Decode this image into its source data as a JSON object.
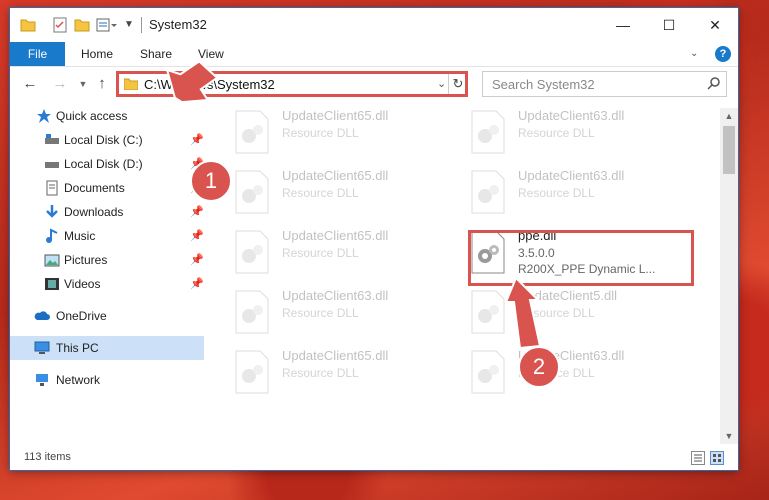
{
  "window": {
    "title": "System32",
    "controls": {
      "minimize": "—",
      "maximize": "☐",
      "close": "✕"
    }
  },
  "ribbon": {
    "tabs": {
      "file": "File",
      "home": "Home",
      "share": "Share",
      "view": "View"
    },
    "help": "?"
  },
  "address": {
    "path": "C:\\Windows\\System32",
    "search_placeholder": "Search System32"
  },
  "sidebar": {
    "items": [
      {
        "label": "Quick access",
        "icon": "star-icon"
      },
      {
        "label": "Local Disk (C:)",
        "icon": "drive-icon"
      },
      {
        "label": "Local Disk (D:)",
        "icon": "drive-icon"
      },
      {
        "label": "Documents",
        "icon": "documents-icon"
      },
      {
        "label": "Downloads",
        "icon": "download-icon"
      },
      {
        "label": "Music",
        "icon": "music-icon"
      },
      {
        "label": "Pictures",
        "icon": "pictures-icon"
      },
      {
        "label": "Videos",
        "icon": "videos-icon"
      },
      {
        "label": "OneDrive",
        "icon": "cloud-icon"
      },
      {
        "label": "This PC",
        "icon": "computer-icon"
      },
      {
        "label": "Network",
        "icon": "network-icon"
      }
    ]
  },
  "files": [
    {
      "name": "UpdateClient65.dll",
      "desc": "Resource DLL"
    },
    {
      "name": "UpdateClient63.dll",
      "desc": "Resource DLL"
    },
    {
      "name": "UpdateClient65.dll",
      "desc": "Resource DLL"
    },
    {
      "name": "UpdateClient63.dll",
      "desc": "Resource DLL"
    },
    {
      "name": "UpdateClient65.dll",
      "desc": "Resource DLL"
    },
    {
      "name": "ppe.dll",
      "desc": "3.5.0.0",
      "desc2": "R200X_PPE Dynamic L..."
    },
    {
      "name": "UpdateClient63.dll",
      "desc": "Resource DLL"
    },
    {
      "name": "UpdateClient5.dll",
      "desc": "Resource DLL"
    },
    {
      "name": "UpdateClient65.dll",
      "desc": "Resource DLL"
    },
    {
      "name": "UpdateClient63.dll",
      "desc": "Resource DLL"
    }
  ],
  "status": {
    "count": "113 items"
  },
  "callouts": {
    "one": "1",
    "two": "2"
  },
  "colors": {
    "accent": "#1979ca",
    "highlight": "#d9534f"
  }
}
